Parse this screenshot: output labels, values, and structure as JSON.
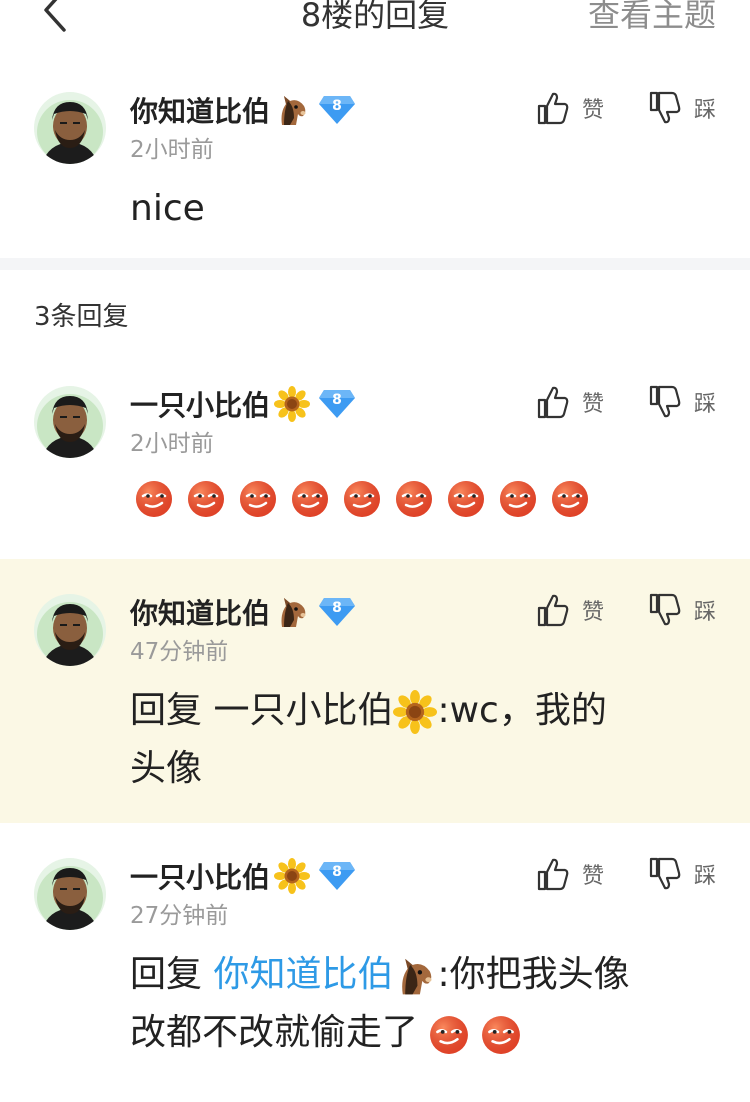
{
  "header": {
    "title": "8楼的回复",
    "view_topic": "查看主题"
  },
  "main_comment": {
    "username": "你知道比伯",
    "badge_icon": "horse-face-icon",
    "level": "8",
    "time": "2小时前",
    "text": "nice",
    "like_label": "赞",
    "dislike_label": "踩"
  },
  "reply_count": "3条回复",
  "replies": [
    {
      "username": "一只小比伯",
      "badge_icon": "sunflower-icon",
      "level": "8",
      "time": "2小时前",
      "emoji_icon": "smirk-face-emoji",
      "emoji_count": 9,
      "like_label": "赞",
      "dislike_label": "踩"
    },
    {
      "username": "你知道比伯",
      "badge_icon": "horse-face-icon",
      "level": "8",
      "time": "47分钟前",
      "reply_prefix": "回复 ",
      "reply_target": "一只小比伯",
      "text_line1": ":wc，我的",
      "text_line2": "头像",
      "like_label": "赞",
      "dislike_label": "踩"
    },
    {
      "username": "一只小比伯",
      "badge_icon": "sunflower-icon",
      "level": "8",
      "time": "27分钟前",
      "reply_prefix": "回复 ",
      "reply_target": "你知道比伯",
      "text_line1": ":你把我头像",
      "text_line2": "改都不改就偷走了",
      "emoji_icon": "smirk-face-emoji",
      "emoji_count": 2,
      "like_label": "赞",
      "dislike_label": "踩"
    }
  ],
  "colors": {
    "mention": "#2e9ae6",
    "highlight_bg": "#fbf8e5",
    "level_badge": "#3d9bf2",
    "emoji": "#e8452a"
  }
}
